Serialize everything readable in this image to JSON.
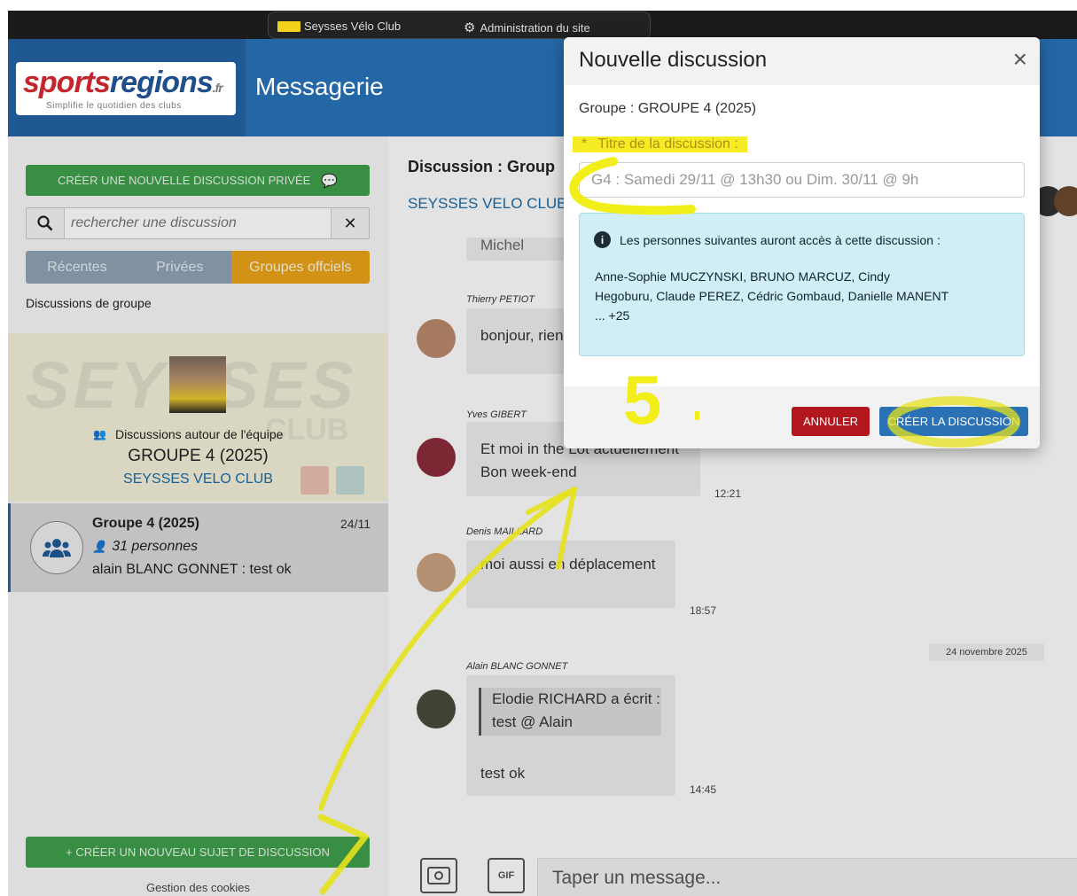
{
  "topbar": {
    "club_label": "Seysses Vélo Club",
    "admin_label": "Administration du site"
  },
  "header": {
    "logo_brand_a": "sports",
    "logo_brand_b": "regions",
    "logo_suffix": ".fr",
    "logo_tagline": "Simplifie le quotidien des clubs",
    "title": "Messagerie"
  },
  "sidebar": {
    "new_private_label": "CRÉER UNE NOUVELLE DISCUSSION PRIVÉE",
    "search_placeholder": "rechercher une discussion",
    "tabs": [
      {
        "label": "Récentes"
      },
      {
        "label": "Privées"
      },
      {
        "label": "Groupes offciels"
      }
    ],
    "section_label": "Discussions de groupe",
    "group_card": {
      "about_label": "Discussions autour de l'équipe",
      "group_name": "GROUPE 4 (2025)",
      "club_name": "SEYSSES VELO CLUB"
    },
    "conversation": {
      "title": "Groupe 4 (2025)",
      "date": "24/11",
      "count": "31 personnes",
      "last_message": "alain BLANC GONNET :  test ok"
    },
    "new_topic_label": "+ CRÉER UN NOUVEAU SUJET DE DISCUSSION",
    "cookies_label": "Gestion des cookies"
  },
  "chat": {
    "title": "Discussion : Group",
    "club": "SEYSSES VELO CLUB",
    "truncated_text": "Michel",
    "messages": [
      {
        "author": "Thierry PETIOT",
        "text": "bonjour, rien"
      },
      {
        "author": "Yves GIBERT",
        "line1": "Et moi in the Lot actuellement",
        "line2": "Bon week-end",
        "time": "12:21"
      },
      {
        "author": "Denis MAILLARD",
        "text": "moi aussi en déplacement",
        "time": "18:57"
      },
      {
        "author": "Alain BLANC GONNET",
        "quote_line1": "Elodie RICHARD a écrit :",
        "quote_line2": "test @ Alain",
        "text": "test ok",
        "time": "14:45"
      }
    ],
    "date_separator": "24 novembre 2025",
    "gif_label": "GIF",
    "composer_placeholder": "Taper un message..."
  },
  "modal": {
    "title": "Nouvelle discussion",
    "group_line": "Groupe : GROUPE 4 (2025)",
    "required_star": "*",
    "field_label": "Titre de la discussion  :",
    "title_value": "G4 : Samedi 29/11 @ 13h30 ou Dim. 30/11 @ 9h",
    "info_heading": "Les personnes suivantes auront accès à cette discussion :",
    "info_names_line1": "Anne-Sophie MUCZYNSKI, BRUNO MARCUZ, Cindy",
    "info_names_line2": "Hegoburu, Claude PEREZ, Cédric Gombaud, Danielle MANENT",
    "info_more": "... +25",
    "cancel_label": "ANNULER",
    "create_label": "CRÉER LA DISCUSSION"
  },
  "annotation": {
    "step_number": "5",
    "color": "#f2ee1a"
  },
  "colors": {
    "header_blue": "#2467a6",
    "green_button": "#3f9f4a",
    "tab_active": "#e9a319",
    "cancel_red": "#b2171d",
    "create_blue": "#2a72b5"
  }
}
